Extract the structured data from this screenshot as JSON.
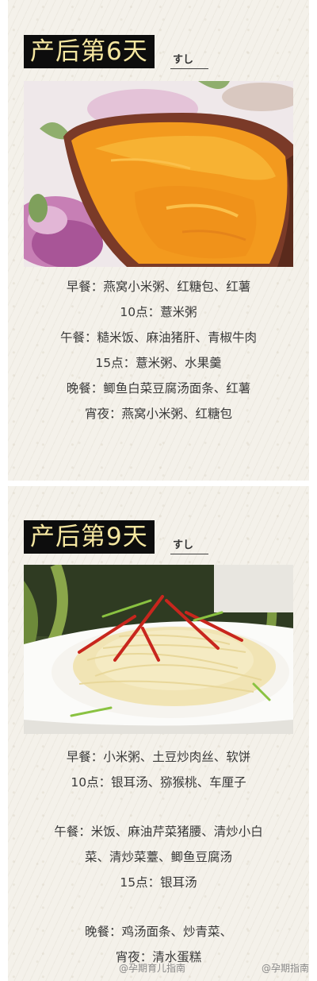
{
  "day6": {
    "title": "产后第6天",
    "suffix": "すし",
    "menu": [
      "早餐：燕窝小米粥、红糖包、红薯",
      "10点：薏米粥",
      "午餐：糙米饭、麻油猪肝、青椒牛肉",
      "15点：薏米粥、水果羹",
      "晚餐：鲫鱼白菜豆腐汤面条、红薯",
      "宵夜：燕窝小米粥、红糖包"
    ]
  },
  "day9": {
    "title": "产后第9天",
    "suffix": "すし",
    "menu_a": [
      "早餐：小米粥、土豆炒肉丝、软饼",
      "10点：银耳汤、猕猴桃、车厘子"
    ],
    "menu_b": [
      "午餐：米饭、麻油芹菜猪腰、清炒小白",
      "菜、清炒菜薹、鲫鱼豆腐汤",
      "15点：银耳汤"
    ],
    "menu_c": [
      "晚餐：鸡汤面条、炒青菜、",
      "宵夜：清水蛋糕"
    ]
  },
  "watermarks": {
    "left": "@孕期育儿指南",
    "right": "@孕期指南"
  }
}
